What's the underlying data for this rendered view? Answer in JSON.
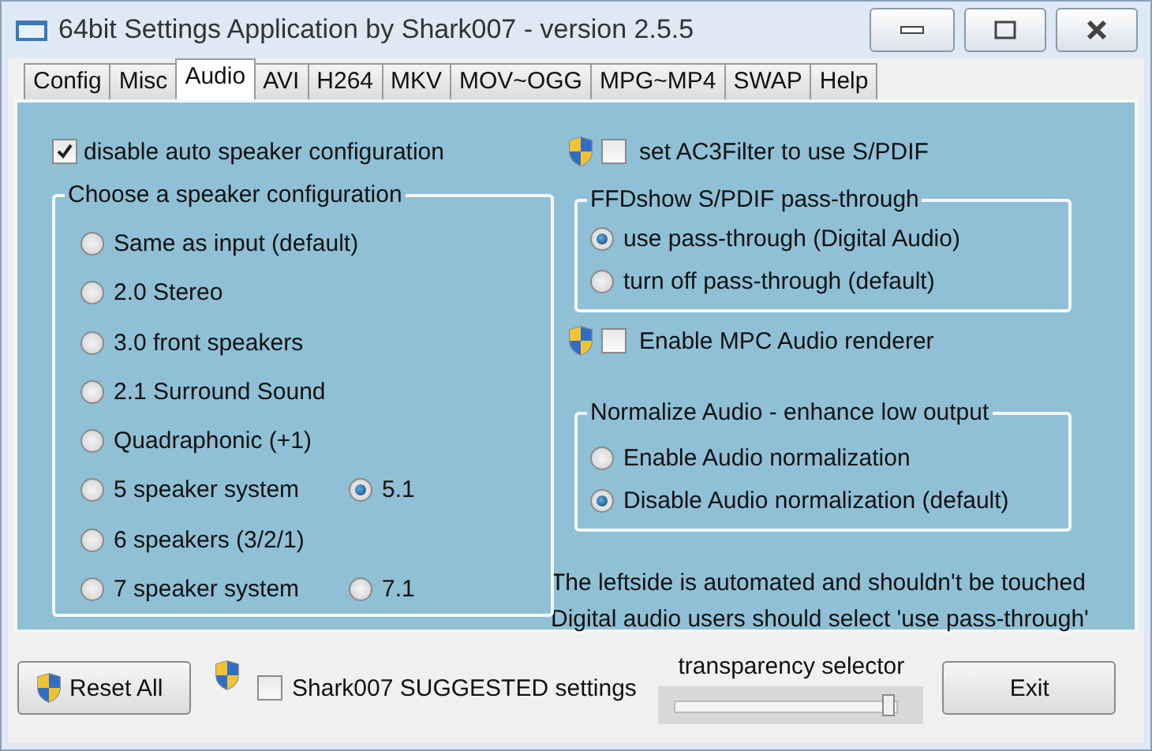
{
  "window": {
    "title": "64bit Settings Application by Shark007 - version 2.5.5"
  },
  "tabs": [
    {
      "label": "Config",
      "selected": false
    },
    {
      "label": "Misc",
      "selected": false
    },
    {
      "label": "Audio",
      "selected": true
    },
    {
      "label": "AVI",
      "selected": false
    },
    {
      "label": "H264",
      "selected": false
    },
    {
      "label": "MKV",
      "selected": false
    },
    {
      "label": "MOV~OGG",
      "selected": false
    },
    {
      "label": "MPG~MP4",
      "selected": false
    },
    {
      "label": "SWAP",
      "selected": false
    },
    {
      "label": "Help",
      "selected": false
    }
  ],
  "auto_speaker": {
    "label": "disable auto speaker configuration",
    "checked": true
  },
  "speaker_group": {
    "title": "Choose a speaker configuration",
    "rows": [
      {
        "options": [
          {
            "label": "Same as input (default)",
            "selected": false
          }
        ]
      },
      {
        "options": [
          {
            "label": "2.0 Stereo",
            "selected": false
          }
        ]
      },
      {
        "options": [
          {
            "label": "3.0 front speakers",
            "selected": false
          }
        ]
      },
      {
        "options": [
          {
            "label": "2.1 Surround Sound",
            "selected": false
          }
        ]
      },
      {
        "options": [
          {
            "label": "Quadraphonic (+1)",
            "selected": false
          }
        ]
      },
      {
        "options": [
          {
            "label": "5 speaker system",
            "selected": false
          },
          {
            "label": "5.1",
            "selected": true
          }
        ]
      },
      {
        "options": [
          {
            "label": "6 speakers (3/2/1)",
            "selected": false
          }
        ]
      },
      {
        "options": [
          {
            "label": "7 speaker system",
            "selected": false
          },
          {
            "label": "7.1",
            "selected": false
          }
        ]
      }
    ]
  },
  "ac3filter": {
    "label": "set AC3Filter to use S/PDIF",
    "checked": false
  },
  "ffdshow_group": {
    "title": "FFDshow S/PDIF pass-through",
    "options": [
      {
        "label": "use pass-through (Digital Audio)",
        "selected": true
      },
      {
        "label": "turn off pass-through (default)",
        "selected": false
      }
    ]
  },
  "mpc_renderer": {
    "label": "Enable MPC Audio renderer",
    "checked": false
  },
  "normalize_group": {
    "title": "Normalize Audio - enhance low output",
    "options": [
      {
        "label": "Enable Audio normalization",
        "selected": false
      },
      {
        "label": "Disable Audio normalization (default)",
        "selected": true
      }
    ]
  },
  "notes": [
    "The leftside is automated and shouldn't be touched",
    "Digital audio users should select 'use pass-through'"
  ],
  "bottom": {
    "reset_button": "Reset All",
    "suggested": {
      "label": "Shark007 SUGGESTED settings",
      "checked": false
    },
    "transparency": {
      "label": "transparency selector",
      "level": 0.97
    },
    "exit_button": "Exit"
  }
}
